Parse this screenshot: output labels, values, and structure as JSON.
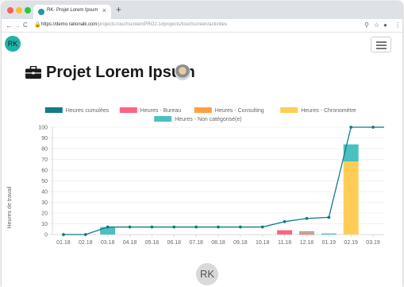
{
  "browser": {
    "tab_title": "RK- Projet Lorem Ipsum",
    "tab_close": "×",
    "new_tab": "+",
    "url_host": "https://demo.rationalk.com",
    "url_path": "/projects-touchscreen/PROJ-1#projects/touchscreen/activities",
    "nav_back": "←",
    "nav_forward": "→",
    "nav_reload": "C"
  },
  "header": {
    "user_initials": "RK"
  },
  "project": {
    "title": "Projet Lorem Ipsum"
  },
  "footer": {
    "user_initials": "RK"
  },
  "chart_data": {
    "type": "bar",
    "xlabel": "",
    "ylabel": "Heures de travail",
    "ylim": [
      0,
      100
    ],
    "yticks": [
      0,
      10,
      20,
      30,
      40,
      50,
      60,
      70,
      80,
      90,
      100
    ],
    "categories": [
      "01.18",
      "02.18",
      "03.18",
      "04.18",
      "05.18",
      "06.18",
      "07.18",
      "08.18",
      "09.18",
      "10.18",
      "11.18",
      "12.18",
      "01.19",
      "02.19",
      "03.19"
    ],
    "grid": true,
    "legend_position": "top",
    "stacked": true,
    "series": [
      {
        "name": "Heures cumulées",
        "type": "line",
        "color": "#117b87",
        "values": [
          0,
          0,
          7,
          7,
          7,
          7,
          7,
          7,
          7,
          7,
          12,
          15,
          16,
          100,
          100
        ]
      },
      {
        "name": "Heures - Bureau",
        "type": "bar",
        "color": "#ff6384",
        "values": [
          0,
          0,
          0,
          0,
          0,
          0,
          0,
          0,
          0,
          0,
          4,
          1,
          0,
          0,
          0
        ]
      },
      {
        "name": "Heures - Consulting",
        "type": "bar",
        "color": "#ff9f40",
        "values": [
          0,
          0,
          0,
          0,
          0,
          0,
          0,
          0,
          0,
          0,
          0,
          1,
          0,
          0,
          0
        ]
      },
      {
        "name": "Heures - Chronomètre",
        "type": "bar",
        "color": "#ffcd56",
        "values": [
          0,
          0,
          0,
          0,
          0,
          0,
          0,
          0,
          0,
          0,
          0,
          0,
          0,
          68,
          0
        ]
      },
      {
        "name": "Heures - Non catégorisé(e)",
        "type": "bar",
        "color": "#4bc0c0",
        "values": [
          0,
          0,
          7,
          0,
          0,
          0,
          0,
          0,
          0,
          0,
          0,
          1,
          1,
          16,
          0
        ]
      }
    ]
  }
}
